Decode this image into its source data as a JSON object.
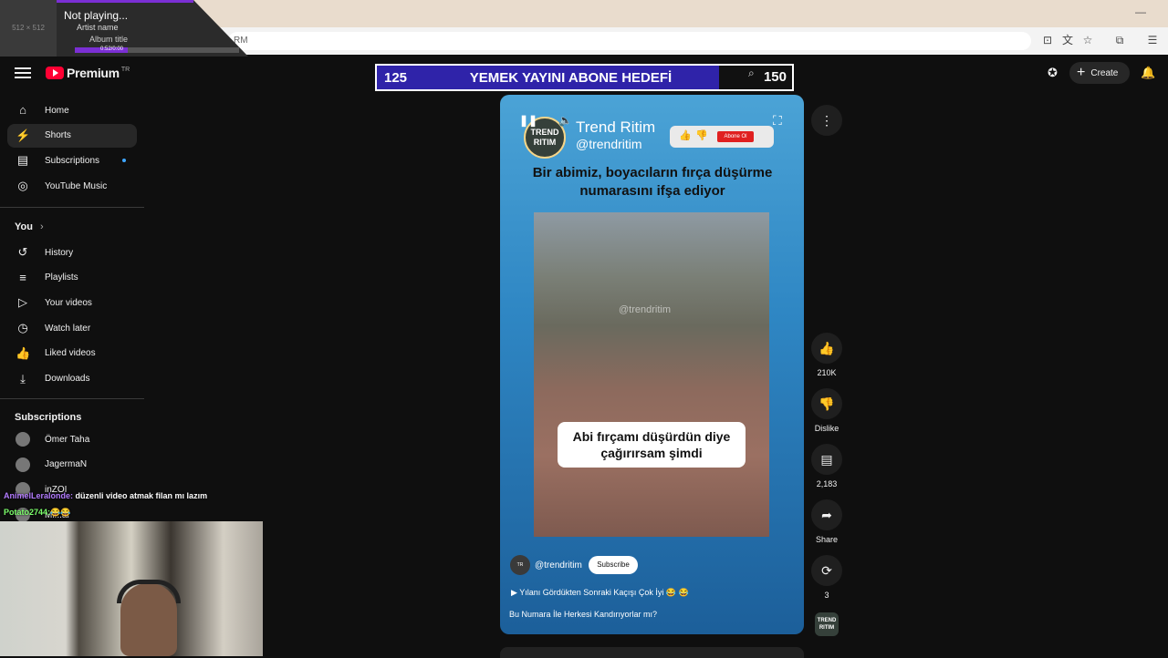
{
  "media": {
    "thumb_label": "512 × 512",
    "status": "Not playing...",
    "artist": "Artist name",
    "album": "Album title",
    "time": "0:52/0:00",
    "progress": 0.32
  },
  "browser": {
    "address_fragment": "RM"
  },
  "header": {
    "logo_text": "Premium",
    "region": "TR",
    "create_label": "Create"
  },
  "sidebar": {
    "main": [
      {
        "label": "Home",
        "icon": "home-icon",
        "glyph": "⌂"
      },
      {
        "label": "Shorts",
        "icon": "shorts-icon",
        "glyph": "⚡"
      },
      {
        "label": "Subscriptions",
        "icon": "subscriptions-icon",
        "glyph": "▤"
      },
      {
        "label": "YouTube Music",
        "icon": "music-icon",
        "glyph": "◎"
      }
    ],
    "you_title": "You",
    "you": [
      {
        "label": "History",
        "icon": "history-icon",
        "glyph": "↺"
      },
      {
        "label": "Playlists",
        "icon": "playlists-icon",
        "glyph": "≡"
      },
      {
        "label": "Your videos",
        "icon": "your-videos-icon",
        "glyph": "▷"
      },
      {
        "label": "Watch later",
        "icon": "watch-later-icon",
        "glyph": "◷"
      },
      {
        "label": "Liked videos",
        "icon": "liked-icon",
        "glyph": "👍"
      },
      {
        "label": "Downloads",
        "icon": "download-icon",
        "glyph": "⤓"
      }
    ],
    "subs_title": "Subscriptions",
    "subs": [
      {
        "label": "Ömer Taha"
      },
      {
        "label": "JagermaN"
      },
      {
        "label": "inZOI"
      },
      {
        "label": "Mi...ar"
      }
    ]
  },
  "goal": {
    "current": "125",
    "title": "YEMEK YAYINI ABONE HEDEFİ",
    "target": "150"
  },
  "short": {
    "channel_name": "Trend Ritim",
    "channel_handle": "@trendritim",
    "avatar_text": "TREND RITIM",
    "pill_button": "Abone Ol",
    "headline": "Bir abimiz, boyacıların fırça düşürme numarasını ifşa ediyor",
    "watermark": "@trendritim",
    "caption": "Abi fırçamı düşürdün diye çağırırsam şimdi",
    "handle": "@trendritim",
    "subscribe_label": "Subscribe",
    "music": "Yılanı Gördükten Sonraki Kaçışı Çok İyi 😂 😂",
    "description": "Bu Numara İle Herkesi Kandırıyorlar mı?"
  },
  "actions": {
    "likes": "210K",
    "dislike": "Dislike",
    "comments": "2,183",
    "share": "Share",
    "remix": "3"
  },
  "chat": [
    {
      "user": "AnimelLeralonde:",
      "text": "düzenli video atmak filan mı lazım"
    },
    {
      "user": "Potato2744:",
      "text": "😂😂"
    }
  ],
  "colors": {
    "youtube_red": "#ff0033",
    "goal_bg": "#2f23a9",
    "accent_blue": "#3ea6ff"
  }
}
